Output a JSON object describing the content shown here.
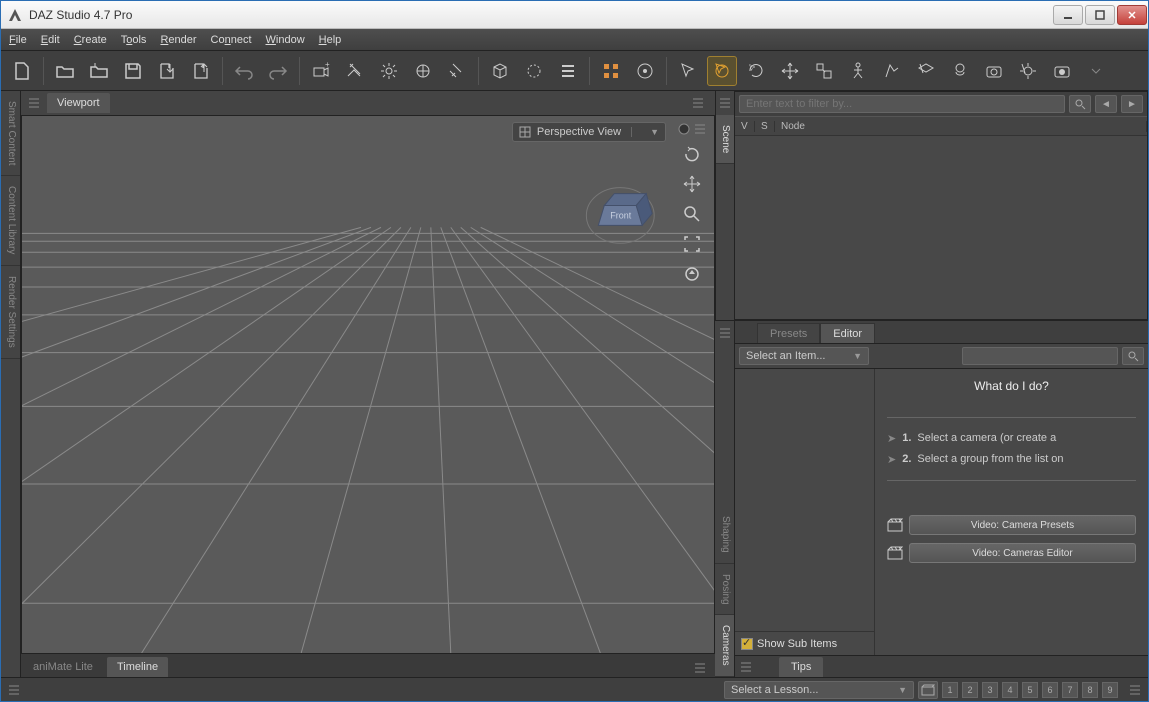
{
  "window_title": "DAZ Studio 4.7 Pro",
  "menus": [
    "File",
    "Edit",
    "Create",
    "Tools",
    "Render",
    "Connect",
    "Window",
    "Help"
  ],
  "viewport_tab": "Viewport",
  "viewport_dropdown": "Perspective View",
  "left_vertical_tabs": [
    "Smart Content",
    "Content Library",
    "Render Settings"
  ],
  "bottom_tabs": {
    "inactive": "aniMate Lite",
    "active": "Timeline"
  },
  "scene": {
    "filter_placeholder": "Enter text to filter by...",
    "cols": {
      "v": "V",
      "s": "S",
      "node": "Node"
    },
    "side_tab": "Scene"
  },
  "editor": {
    "tabs": {
      "presets": "Presets",
      "editor": "Editor"
    },
    "select_item": "Select an Item...",
    "show_sub": "Show Sub Items",
    "heading": "What do I do?",
    "step1_n": "1.",
    "step1": "Select a camera (or create a",
    "step2_n": "2.",
    "step2": "Select a group from the list on",
    "video1": "Video: Camera Presets",
    "video2": "Video: Cameras Editor",
    "side_tabs": [
      "Shaping",
      "Posing",
      "Cameras"
    ],
    "tips": "Tips"
  },
  "status": {
    "lesson": "Select a Lesson...",
    "nums": [
      "1",
      "2",
      "3",
      "4",
      "5",
      "6",
      "7",
      "8",
      "9"
    ]
  }
}
